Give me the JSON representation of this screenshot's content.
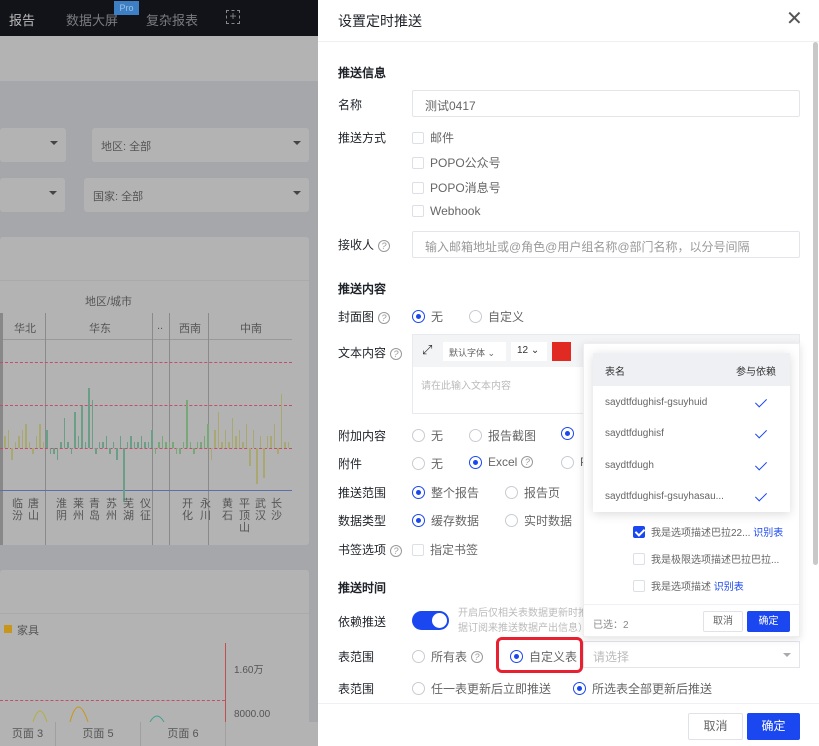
{
  "nav": {
    "tabs": [
      "报告",
      "数据大屏",
      "复杂报表"
    ],
    "pro_badge": "Pro"
  },
  "filters": {
    "region": "地区: 全部",
    "country": "国家: 全部"
  },
  "chart1": {
    "title": "地区/城市",
    "groups": [
      "华北",
      "华东",
      "..",
      "西南",
      "中南"
    ],
    "cities": [
      "临汾",
      "唐山",
      "淮阴",
      "莱州",
      "青岛",
      "苏州",
      "芜湖",
      "仪征",
      "开化",
      "永川",
      "黄石",
      "平顶山",
      "武汉",
      "长沙"
    ],
    "bars": [
      2,
      3,
      -2,
      1,
      2,
      3,
      4,
      1,
      -1,
      2,
      4,
      1,
      3,
      -1,
      -1,
      -2,
      1,
      5,
      1,
      -1,
      6,
      2,
      7,
      1,
      10,
      8,
      -1,
      1,
      1,
      2,
      -1,
      1,
      -2,
      2,
      -9,
      1,
      2,
      1,
      1,
      2,
      1,
      1,
      3,
      -1,
      1,
      2,
      1,
      1,
      1,
      -1,
      -1,
      1,
      8,
      1,
      -1,
      1,
      1,
      2,
      4,
      -2,
      3,
      6,
      1,
      3,
      1,
      5,
      2,
      3,
      1,
      4,
      -3,
      3,
      -6,
      2,
      -5,
      2,
      2,
      4,
      -1,
      9,
      1,
      1
    ]
  },
  "chart2": {
    "legend": "家具",
    "legend_color": "#c8961a",
    "y_labels": [
      "1.60万",
      "8000.00"
    ]
  },
  "page_tabs": [
    "页面 3",
    "页面 5",
    "页面 6"
  ],
  "drawer": {
    "title": "设置定时推送",
    "sec_info": "推送信息",
    "name_label": "名称",
    "name_value": "测试0417",
    "method_label": "推送方式",
    "methods": [
      "邮件",
      "POPO公众号",
      "POPO消息号",
      "Webhook"
    ],
    "receiver_label": "接收人",
    "receiver_placeholder": "输入邮箱地址或@角色@用户组名称@部门名称，以分号间隔",
    "sec_content": "推送内容",
    "cover_label": "封面图",
    "cover_options": [
      "无",
      "自定义"
    ],
    "text_label": "文本内容",
    "font": "默认字体",
    "size": "12",
    "text_placeholder": "请在此输入文本内容",
    "text_color": "#e02a22",
    "extra_label": "附加内容",
    "extra_options": [
      "无",
      "报告截图"
    ],
    "attach_label": "附件",
    "attach_options": [
      "无",
      "Excel",
      "P"
    ],
    "scope_label": "推送范围",
    "scope_options": [
      "整个报告",
      "报告页"
    ],
    "dtype_label": "数据类型",
    "dtype_options": [
      "缓存数据",
      "实时数据"
    ],
    "bookmark_label": "书签选项",
    "bookmark_option": "指定书签",
    "sec_time": "推送时间",
    "dep_label": "依赖推送",
    "dep_on": true,
    "dep_help": [
      "开启后仅相关表数据更新时推",
      "据订阅来推送数据产出信息）"
    ],
    "table_scope_label": "表范围",
    "table_scope_options": [
      "所有表",
      "自定义表"
    ],
    "table_select_placeholder": "请选择",
    "trigger_label": "表范围",
    "trigger_options": [
      "任一表更新后立即推送",
      "所选表全部更新后推送"
    ],
    "cancel": "取消",
    "ok": "确定"
  },
  "popover": {
    "table_headers": [
      "表名",
      "参与依赖"
    ],
    "table_rows": [
      "saydtfdughisf-gsuyhuid",
      "saydtfdughisf",
      "saydtfdugh",
      "saydtfdughisf-gsuyhasau..."
    ],
    "options": [
      {
        "label": "我是选项描述巴拉22...",
        "link": "识别表",
        "checked": true
      },
      {
        "label": "我是极限选项描述巴拉巴拉...",
        "link": "",
        "checked": false
      },
      {
        "label": "我是选项描述",
        "link": "识别表",
        "checked": false
      }
    ],
    "selected": "已选：2",
    "cancel": "取消",
    "ok": "确定"
  }
}
